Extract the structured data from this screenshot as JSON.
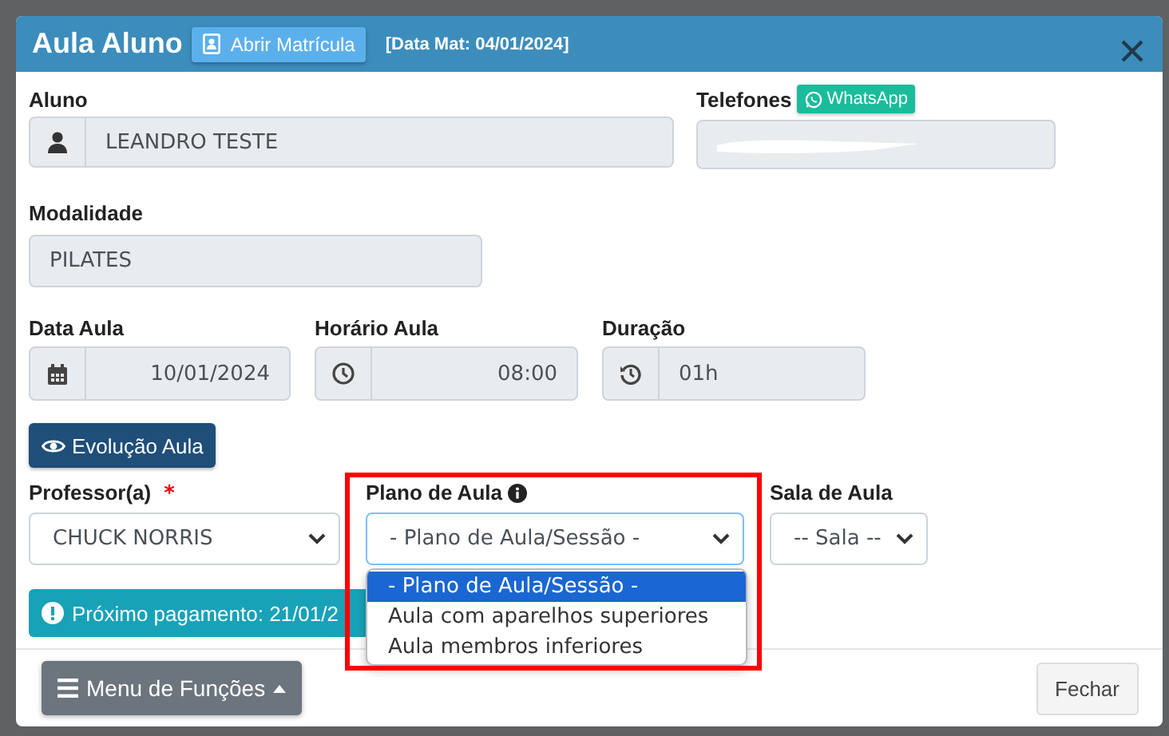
{
  "modal": {
    "title": "Aula Aluno",
    "enrollment_button": "Abrir Matrícula",
    "enrollment_date": "[Data Mat: 04/01/2024]"
  },
  "student": {
    "label": "Aluno",
    "value": "LEANDRO TESTE"
  },
  "phones": {
    "label": "Telefones",
    "whatsapp_button": "WhatsApp"
  },
  "modality": {
    "label": "Modalidade",
    "value": "PILATES"
  },
  "class_date": {
    "label": "Data Aula",
    "value": "10/01/2024"
  },
  "class_time": {
    "label": "Horário Aula",
    "value": "08:00"
  },
  "duration": {
    "label": "Duração",
    "value": "01h"
  },
  "evolution_button": "Evolução Aula",
  "teacher": {
    "label": "Professor(a)",
    "required_mark": "*",
    "value": "CHUCK NORRIS"
  },
  "lesson_plan": {
    "label": "Plano de Aula",
    "value": "- Plano de Aula/Sessão -",
    "expanded": true,
    "options": [
      {
        "label": "- Plano de Aula/Sessão -",
        "selected": true
      },
      {
        "label": "Aula com aparelhos superiores",
        "selected": false
      },
      {
        "label": "Aula membros inferiores",
        "selected": false
      }
    ]
  },
  "room": {
    "label": "Sala de Aula",
    "value": "-- Sala --"
  },
  "payment_alert": "Próximo pagamento: 21/01/2",
  "footer": {
    "menu_button": "Menu de Funções",
    "close_button": "Fechar"
  }
}
